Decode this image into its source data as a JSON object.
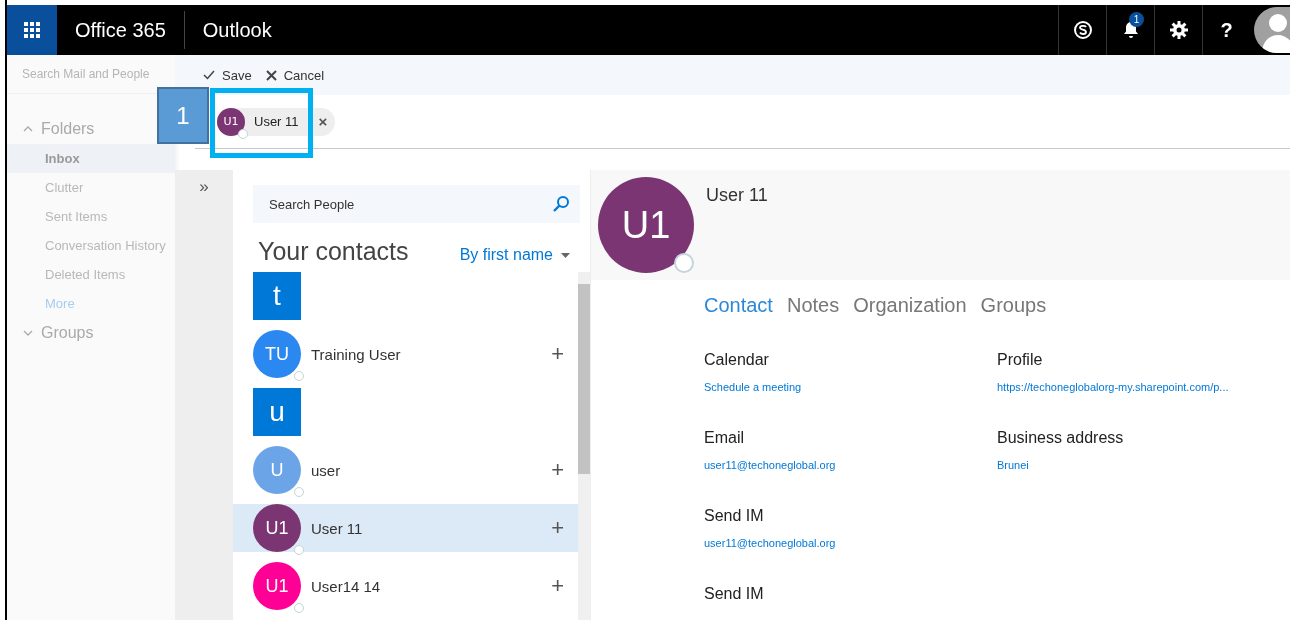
{
  "topbar": {
    "brand": "Office 365",
    "app": "Outlook",
    "notification_count": "1",
    "help": "?"
  },
  "sidebar": {
    "search": {
      "placeholder": "Search Mail and People"
    },
    "folders_header": {
      "label": "Folders",
      "expanded": true
    },
    "items": [
      {
        "label": "Inbox",
        "selected": true,
        "kind": "folder"
      },
      {
        "label": "Clutter",
        "selected": false,
        "kind": "folder"
      },
      {
        "label": "Sent Items",
        "selected": false,
        "kind": "folder"
      },
      {
        "label": "Conversation History",
        "selected": false,
        "kind": "folder"
      },
      {
        "label": "Deleted Items",
        "selected": false,
        "kind": "folder"
      },
      {
        "label": "More",
        "selected": false,
        "kind": "link"
      }
    ],
    "groups_header": {
      "label": "Groups",
      "expanded": false
    }
  },
  "commands": [
    {
      "label": "Save"
    },
    {
      "label": "Cancel"
    }
  ],
  "recipient_chip": {
    "initials": "U1",
    "name": "User 11",
    "remove": "×",
    "color": "#7b3572"
  },
  "callout": {
    "number": "1"
  },
  "collapse": "»",
  "people": {
    "search": {
      "placeholder": "Search People"
    },
    "heading": "Your contacts",
    "sort": "By first name",
    "list": [
      {
        "kind": "letter",
        "label": "t"
      },
      {
        "kind": "contact",
        "initials": "TU",
        "name": "Training User",
        "color": "#2b88f0",
        "selected": false,
        "add": "+"
      },
      {
        "kind": "letter",
        "label": "u"
      },
      {
        "kind": "contact",
        "initials": "U",
        "name": "user",
        "color": "#6ca4e8",
        "selected": false,
        "add": "+"
      },
      {
        "kind": "contact",
        "initials": "U1",
        "name": "User 11",
        "color": "#7b3572",
        "selected": true,
        "add": "+"
      },
      {
        "kind": "contact",
        "initials": "U1",
        "name": "User14 14",
        "color": "#ff0097",
        "selected": false,
        "add": "+"
      }
    ]
  },
  "detail": {
    "initials": "U1",
    "name": "User 11",
    "color": "#7b3572",
    "tabs": [
      {
        "label": "Contact",
        "selected": true
      },
      {
        "label": "Notes",
        "selected": false
      },
      {
        "label": "Organization",
        "selected": false
      },
      {
        "label": "Groups",
        "selected": false
      }
    ],
    "field_rows": [
      [
        {
          "label": "Calendar",
          "value": "Schedule a meeting"
        },
        {
          "label": "Profile",
          "value": "https://techoneglobalorg-my.sharepoint.com/p..."
        }
      ],
      [
        {
          "label": "Email",
          "value": "user11@techoneglobal.org"
        },
        {
          "label": "Business address",
          "value": "Brunei"
        }
      ],
      [
        {
          "label": "Send IM",
          "value": "user11@techoneglobal.org"
        }
      ],
      [
        {
          "label": "Send IM"
        }
      ]
    ]
  }
}
